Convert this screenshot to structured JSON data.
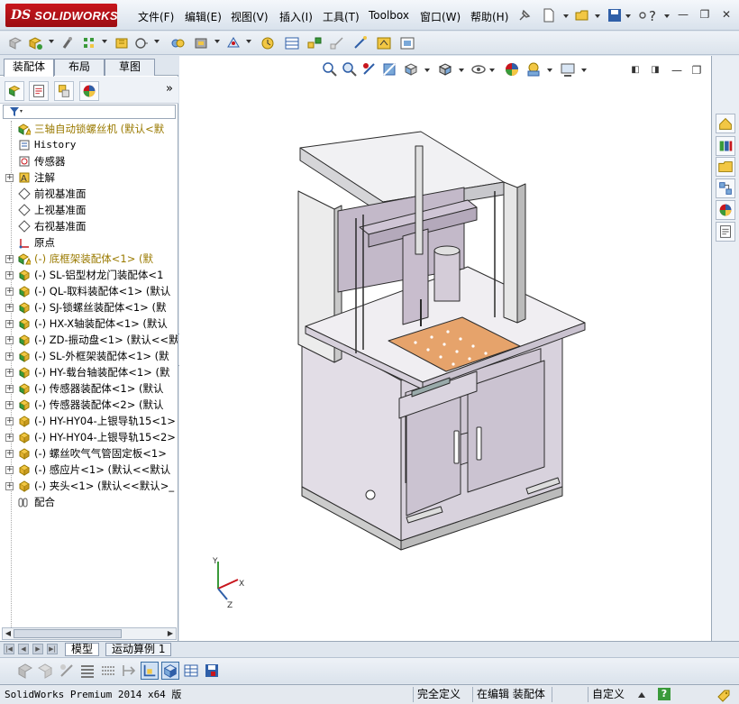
{
  "app": {
    "logo_ds": "DS",
    "logo_text": "SOLIDWORKS"
  },
  "menu": [
    {
      "label": "文件(F)"
    },
    {
      "label": "编辑(E)"
    },
    {
      "label": "视图(V)"
    },
    {
      "label": "插入(I)"
    },
    {
      "label": "工具(T)"
    },
    {
      "label": "Toolbox"
    },
    {
      "label": "窗口(W)"
    },
    {
      "label": "帮助(H)"
    }
  ],
  "command_manager_tabs": [
    {
      "label": "装配体",
      "active": true
    },
    {
      "label": "布局",
      "active": false
    },
    {
      "label": "草图",
      "active": false
    }
  ],
  "feature_tree": {
    "more_label": "»",
    "items": [
      {
        "label": "三轴自动锁螺丝机 (默认<默",
        "expander": "",
        "icon": "assembly-warning-icon",
        "warn": true
      },
      {
        "label": "History",
        "expander": "",
        "icon": "history-icon",
        "mono": true
      },
      {
        "label": "传感器",
        "expander": "",
        "icon": "sensor-icon"
      },
      {
        "label": "注解",
        "expander": "+",
        "icon": "annotation-icon"
      },
      {
        "label": "前视基准面",
        "expander": "",
        "icon": "plane-icon"
      },
      {
        "label": "上视基准面",
        "expander": "",
        "icon": "plane-icon"
      },
      {
        "label": "右视基准面",
        "expander": "",
        "icon": "plane-icon"
      },
      {
        "label": "原点",
        "expander": "",
        "icon": "origin-icon"
      },
      {
        "label": "(-) 底框架装配体<1> (默",
        "expander": "+",
        "icon": "subassembly-warning-icon",
        "warn": true
      },
      {
        "label": "(-) SL-铝型材龙门装配体<1",
        "expander": "+",
        "icon": "subassembly-icon"
      },
      {
        "label": "(-) QL-取料装配体<1> (默认",
        "expander": "+",
        "icon": "subassembly-icon"
      },
      {
        "label": "(-) SJ-锁螺丝装配体<1> (默",
        "expander": "+",
        "icon": "subassembly-icon"
      },
      {
        "label": "(-) HX-X轴装配体<1> (默认",
        "expander": "+",
        "icon": "subassembly-icon"
      },
      {
        "label": "(-) ZD-振动盘<1> (默认<<默",
        "expander": "+",
        "icon": "subassembly-icon"
      },
      {
        "label": "(-) SL-外框架装配体<1> (默",
        "expander": "+",
        "icon": "subassembly-icon"
      },
      {
        "label": "(-) HY-载台轴装配体<1> (默",
        "expander": "+",
        "icon": "subassembly-icon"
      },
      {
        "label": "(-) 传感器装配体<1> (默认",
        "expander": "+",
        "icon": "subassembly-icon"
      },
      {
        "label": "(-) 传感器装配体<2> (默认",
        "expander": "+",
        "icon": "subassembly-icon"
      },
      {
        "label": "(-) HY-HY04-上银导轨15<1>",
        "expander": "+",
        "icon": "part-icon"
      },
      {
        "label": "(-) HY-HY04-上银导轨15<2>",
        "expander": "+",
        "icon": "part-icon"
      },
      {
        "label": "(-) 螺丝吹气气管固定板<1>",
        "expander": "+",
        "icon": "part-icon"
      },
      {
        "label": "(-) 感应片<1> (默认<<默认",
        "expander": "+",
        "icon": "part-icon"
      },
      {
        "label": "(-) 夹头<1> (默认<<默认>_",
        "expander": "+",
        "icon": "part-icon"
      },
      {
        "label": "配合",
        "expander": "",
        "icon": "mates-icon"
      }
    ]
  },
  "bottom_tabs": [
    {
      "label": "模型",
      "active": true
    },
    {
      "label": "运动算例 1",
      "active": false
    }
  ],
  "triad": {
    "x": "X",
    "y": "Y",
    "z": "Z"
  },
  "status": {
    "app_version": "SolidWorks Premium 2014 x64 版",
    "fully_defined": "完全定义",
    "editing": "在编辑 装配体",
    "units": "自定义",
    "help_badge": "?"
  },
  "colors": {
    "logo_red": "#c8161d",
    "model_face": "#e6e1ea",
    "model_edge": "#2b2b2b",
    "accent_orange": "#e6a36b",
    "panel_bg": "#dfe6ee"
  }
}
